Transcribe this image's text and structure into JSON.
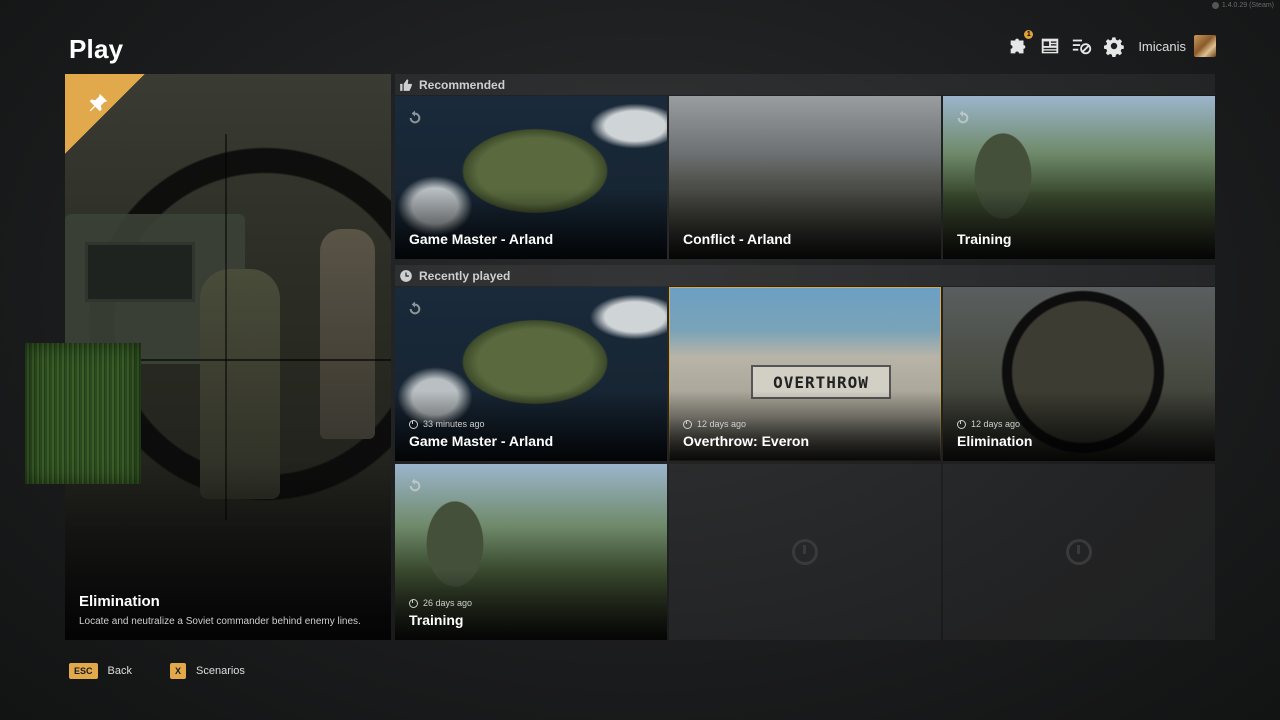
{
  "version": "1.4.0.29 (Steam)",
  "page": {
    "title": "Play"
  },
  "topbar": {
    "badge_count": "1",
    "username": "Imicanis"
  },
  "featured": {
    "title": "Elimination",
    "description": "Locate and neutralize a Soviet commander behind enemy lines."
  },
  "recommended": {
    "header": "Recommended",
    "cards": [
      {
        "title": "Game Master - Arland"
      },
      {
        "title": "Conflict - Arland"
      },
      {
        "title": "Training"
      }
    ]
  },
  "recent": {
    "header": "Recently played",
    "cards": [
      {
        "title": "Game Master - Arland",
        "time": "33 minutes ago"
      },
      {
        "title": "Overthrow: Everon",
        "time": "12 days ago",
        "sign": "OVERTHROW"
      },
      {
        "title": "Elimination",
        "time": "12 days ago"
      },
      {
        "title": "Training",
        "time": "26 days ago"
      }
    ]
  },
  "footer": {
    "back_key": "ESC",
    "back_label": "Back",
    "scen_key": "X",
    "scen_label": "Scenarios"
  },
  "colors": {
    "accent": "#e1a94b",
    "highlight": "#d9a94a"
  }
}
